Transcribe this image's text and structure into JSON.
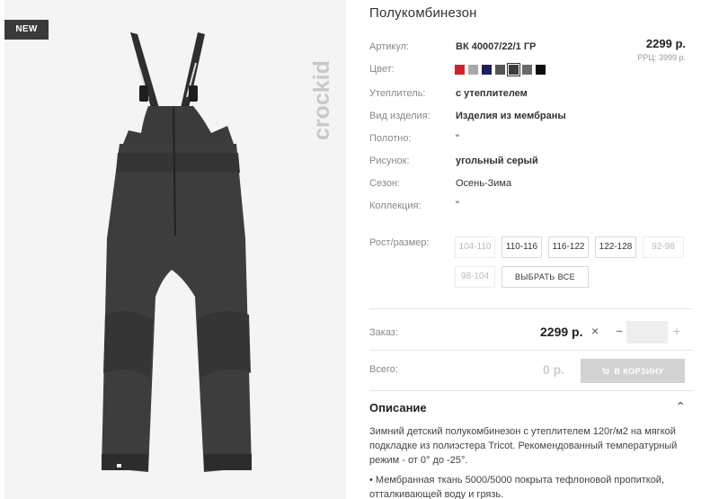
{
  "badge": {
    "label": "NEW"
  },
  "brand": {
    "logo_text": "crockid"
  },
  "product": {
    "title": "Полукомбинезон",
    "price": "2299 р.",
    "rrp": "РРЦ: 3999 р."
  },
  "attributes": [
    {
      "label": "Артикул:",
      "value": "ВК 40007/22/1 ГР"
    },
    {
      "label": "Цвет:",
      "value": ""
    },
    {
      "label": "Утеплитель:",
      "value": "с утеплителем"
    },
    {
      "label": "Вид изделия:",
      "value": "Изделия из мембраны"
    },
    {
      "label": "Полотно:",
      "value": "\""
    },
    {
      "label": "Рисунок:",
      "value": "угольный серый"
    },
    {
      "label": "Сезон:",
      "value": "Осень-Зима"
    },
    {
      "label": "Коллекция:",
      "value": "\""
    }
  ],
  "colors": [
    {
      "name": "red",
      "hex": "#d0202a",
      "selected": false
    },
    {
      "name": "light-gray",
      "hex": "#a8a8a8",
      "selected": false
    },
    {
      "name": "navy",
      "hex": "#1b1f5e",
      "selected": false
    },
    {
      "name": "dark-gray",
      "hex": "#555555",
      "selected": false
    },
    {
      "name": "charcoal",
      "hex": "#3c3c3c",
      "selected": true
    },
    {
      "name": "graphite",
      "hex": "#6a6a6a",
      "selected": false
    },
    {
      "name": "black",
      "hex": "#0d0d0d",
      "selected": false
    }
  ],
  "sizes": {
    "label": "Рост/размер:",
    "options": [
      {
        "label": "104-110",
        "available": false
      },
      {
        "label": "110-116",
        "available": true
      },
      {
        "label": "116-122",
        "available": true
      },
      {
        "label": "122-128",
        "available": true
      },
      {
        "label": "92-98",
        "available": false
      },
      {
        "label": "98-104",
        "available": false
      }
    ],
    "select_all": "ВЫБРАТЬ ВСЕ"
  },
  "order": {
    "label": "Заказ:",
    "price": "2299 р.",
    "remove_symbol": "×",
    "minus": "−",
    "plus": "+",
    "quantity": ""
  },
  "total": {
    "label": "Всего:",
    "value": "0 р.",
    "cart_button": "В КОРЗИНУ"
  },
  "description": {
    "title": "Описание",
    "chevron": "⌃",
    "text": "Зимний детский полукомбинезон с утеплителем 120г/м2 на мягкой подкладке из полиэстера Tricot. Рекомендованный температурный режим - от 0° до -25°.",
    "bullet": "• Мембранная ткань 5000/5000 покрыта тефлоновой пропиткой, отталкивающей воду и грязь."
  }
}
